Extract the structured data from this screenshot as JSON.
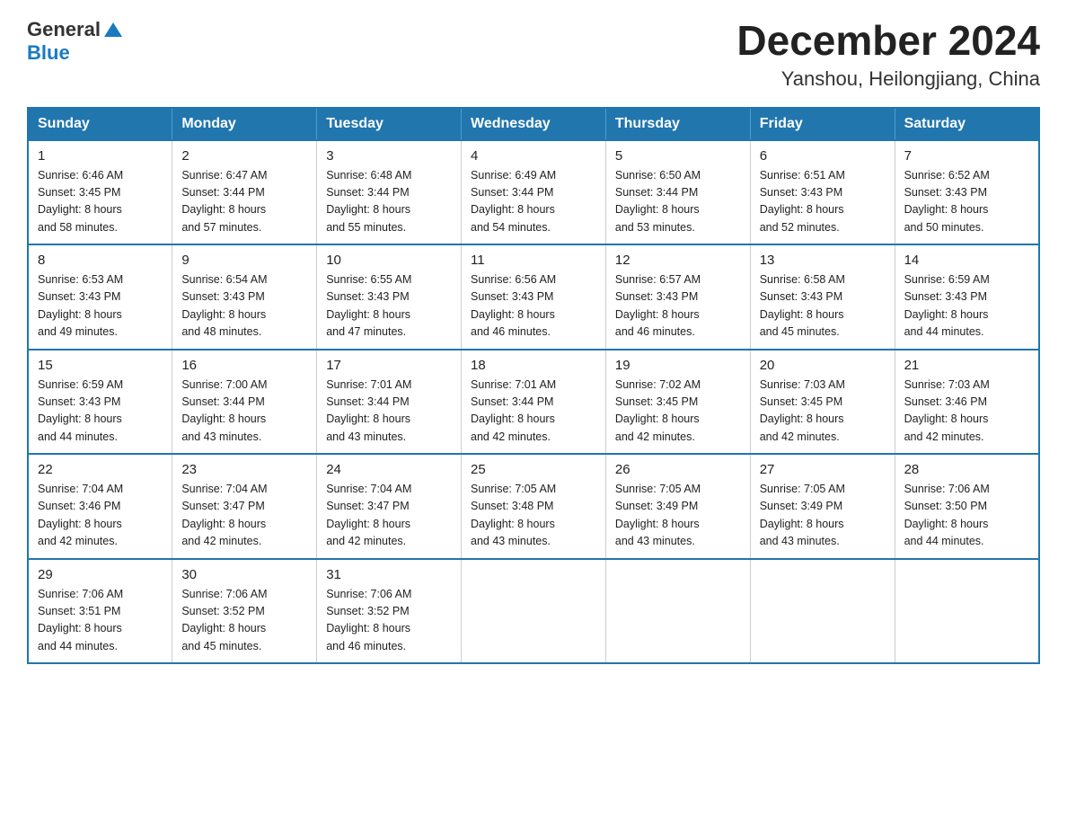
{
  "header": {
    "title": "December 2024",
    "subtitle": "Yanshou, Heilongjiang, China",
    "logo_general": "General",
    "logo_blue": "Blue"
  },
  "days_of_week": [
    "Sunday",
    "Monday",
    "Tuesday",
    "Wednesday",
    "Thursday",
    "Friday",
    "Saturday"
  ],
  "weeks": [
    [
      {
        "num": "1",
        "sunrise": "6:46 AM",
        "sunset": "3:45 PM",
        "daylight": "8 hours and 58 minutes."
      },
      {
        "num": "2",
        "sunrise": "6:47 AM",
        "sunset": "3:44 PM",
        "daylight": "8 hours and 57 minutes."
      },
      {
        "num": "3",
        "sunrise": "6:48 AM",
        "sunset": "3:44 PM",
        "daylight": "8 hours and 55 minutes."
      },
      {
        "num": "4",
        "sunrise": "6:49 AM",
        "sunset": "3:44 PM",
        "daylight": "8 hours and 54 minutes."
      },
      {
        "num": "5",
        "sunrise": "6:50 AM",
        "sunset": "3:44 PM",
        "daylight": "8 hours and 53 minutes."
      },
      {
        "num": "6",
        "sunrise": "6:51 AM",
        "sunset": "3:43 PM",
        "daylight": "8 hours and 52 minutes."
      },
      {
        "num": "7",
        "sunrise": "6:52 AM",
        "sunset": "3:43 PM",
        "daylight": "8 hours and 50 minutes."
      }
    ],
    [
      {
        "num": "8",
        "sunrise": "6:53 AM",
        "sunset": "3:43 PM",
        "daylight": "8 hours and 49 minutes."
      },
      {
        "num": "9",
        "sunrise": "6:54 AM",
        "sunset": "3:43 PM",
        "daylight": "8 hours and 48 minutes."
      },
      {
        "num": "10",
        "sunrise": "6:55 AM",
        "sunset": "3:43 PM",
        "daylight": "8 hours and 47 minutes."
      },
      {
        "num": "11",
        "sunrise": "6:56 AM",
        "sunset": "3:43 PM",
        "daylight": "8 hours and 46 minutes."
      },
      {
        "num": "12",
        "sunrise": "6:57 AM",
        "sunset": "3:43 PM",
        "daylight": "8 hours and 46 minutes."
      },
      {
        "num": "13",
        "sunrise": "6:58 AM",
        "sunset": "3:43 PM",
        "daylight": "8 hours and 45 minutes."
      },
      {
        "num": "14",
        "sunrise": "6:59 AM",
        "sunset": "3:43 PM",
        "daylight": "8 hours and 44 minutes."
      }
    ],
    [
      {
        "num": "15",
        "sunrise": "6:59 AM",
        "sunset": "3:43 PM",
        "daylight": "8 hours and 44 minutes."
      },
      {
        "num": "16",
        "sunrise": "7:00 AM",
        "sunset": "3:44 PM",
        "daylight": "8 hours and 43 minutes."
      },
      {
        "num": "17",
        "sunrise": "7:01 AM",
        "sunset": "3:44 PM",
        "daylight": "8 hours and 43 minutes."
      },
      {
        "num": "18",
        "sunrise": "7:01 AM",
        "sunset": "3:44 PM",
        "daylight": "8 hours and 42 minutes."
      },
      {
        "num": "19",
        "sunrise": "7:02 AM",
        "sunset": "3:45 PM",
        "daylight": "8 hours and 42 minutes."
      },
      {
        "num": "20",
        "sunrise": "7:03 AM",
        "sunset": "3:45 PM",
        "daylight": "8 hours and 42 minutes."
      },
      {
        "num": "21",
        "sunrise": "7:03 AM",
        "sunset": "3:46 PM",
        "daylight": "8 hours and 42 minutes."
      }
    ],
    [
      {
        "num": "22",
        "sunrise": "7:04 AM",
        "sunset": "3:46 PM",
        "daylight": "8 hours and 42 minutes."
      },
      {
        "num": "23",
        "sunrise": "7:04 AM",
        "sunset": "3:47 PM",
        "daylight": "8 hours and 42 minutes."
      },
      {
        "num": "24",
        "sunrise": "7:04 AM",
        "sunset": "3:47 PM",
        "daylight": "8 hours and 42 minutes."
      },
      {
        "num": "25",
        "sunrise": "7:05 AM",
        "sunset": "3:48 PM",
        "daylight": "8 hours and 43 minutes."
      },
      {
        "num": "26",
        "sunrise": "7:05 AM",
        "sunset": "3:49 PM",
        "daylight": "8 hours and 43 minutes."
      },
      {
        "num": "27",
        "sunrise": "7:05 AM",
        "sunset": "3:49 PM",
        "daylight": "8 hours and 43 minutes."
      },
      {
        "num": "28",
        "sunrise": "7:06 AM",
        "sunset": "3:50 PM",
        "daylight": "8 hours and 44 minutes."
      }
    ],
    [
      {
        "num": "29",
        "sunrise": "7:06 AM",
        "sunset": "3:51 PM",
        "daylight": "8 hours and 44 minutes."
      },
      {
        "num": "30",
        "sunrise": "7:06 AM",
        "sunset": "3:52 PM",
        "daylight": "8 hours and 45 minutes."
      },
      {
        "num": "31",
        "sunrise": "7:06 AM",
        "sunset": "3:52 PM",
        "daylight": "8 hours and 46 minutes."
      },
      null,
      null,
      null,
      null
    ]
  ],
  "labels": {
    "sunrise": "Sunrise:",
    "sunset": "Sunset:",
    "daylight": "Daylight:"
  }
}
